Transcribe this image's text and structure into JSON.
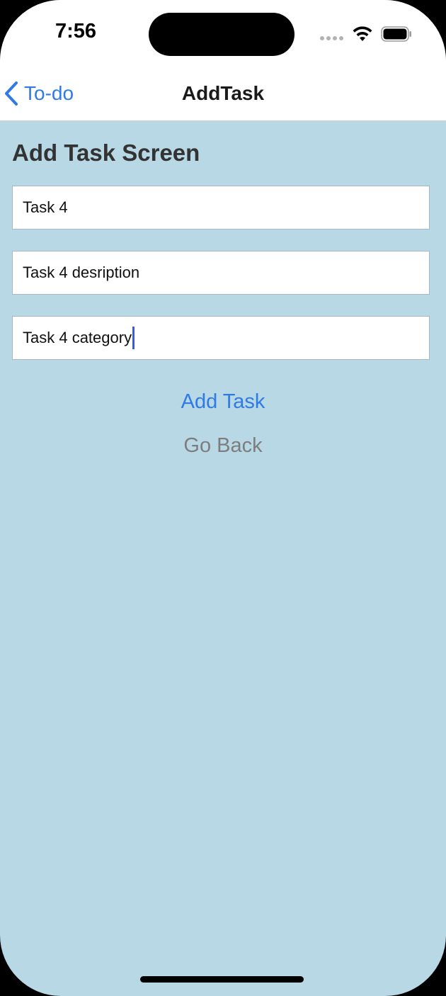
{
  "status_bar": {
    "time": "7:56",
    "icons": [
      "cellular-signal-icon",
      "wifi-icon",
      "battery-icon"
    ]
  },
  "nav_bar": {
    "back_label": "To-do",
    "title": "AddTask"
  },
  "form": {
    "heading": "Add Task Screen",
    "title_value": "Task 4",
    "description_value": "Task 4 desription",
    "category_value": "Task 4 category",
    "add_task_label": "Add Task",
    "go_back_label": "Go Back"
  },
  "colors": {
    "background": "#b7d8e4",
    "accent": "#2f7ae5",
    "muted_button": "#7d7d7d",
    "cursor": "#3b5bdb"
  }
}
